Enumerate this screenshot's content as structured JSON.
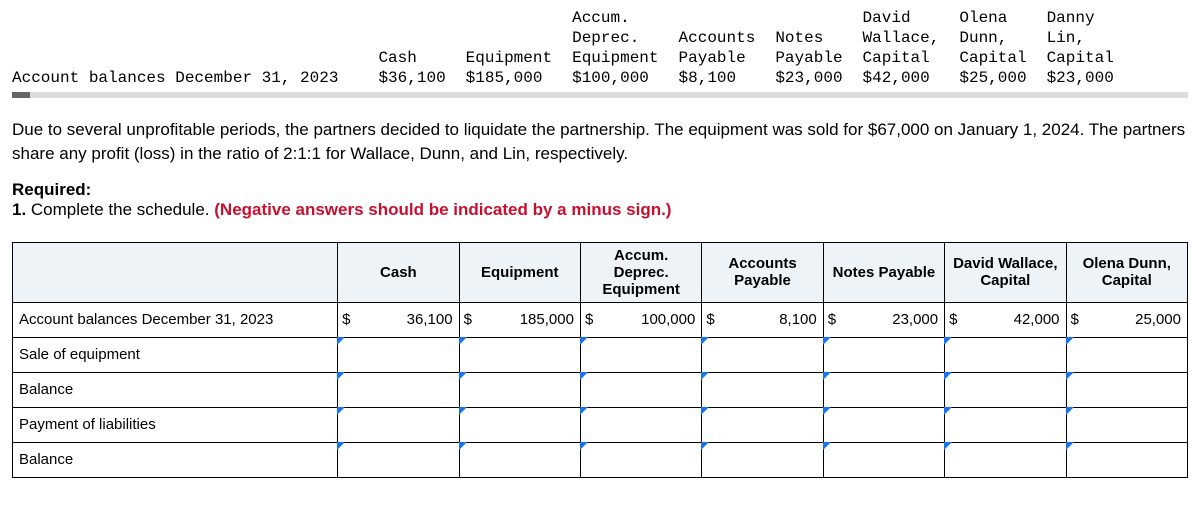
{
  "top": {
    "rowLabel": "Account balances December 31, 2023",
    "headers": {
      "cash": "Cash",
      "equipment": "Equipment",
      "accumHead": "Accum.\nDeprec.\nEquipment",
      "accounts": "Accounts\nPayable",
      "notes": "Notes\nPayable",
      "wallace": "David\nWallace,\nCapital",
      "dunn": "Olena\nDunn,\nCapital",
      "lin": "Danny\nLin,\nCapital"
    },
    "values": {
      "cash": "$36,100",
      "equipment": "$185,000",
      "accum": "$100,000",
      "accounts": "$8,100",
      "notes": "$23,000",
      "wallace": "$42,000",
      "dunn": "$25,000",
      "lin": "$23,000"
    }
  },
  "para": "Due to several unprofitable periods, the partners decided to liquidate the partnership. The equipment was sold for $67,000 on January 1, 2024. The partners share any profit (loss) in the ratio of 2:1:1 for Wallace, Dunn, and Lin, respectively.",
  "required": {
    "head": "Required:",
    "line_num": "1. ",
    "line_text": "Complete the schedule. ",
    "line_red": "(Negative answers should be indicated by a minus sign.)"
  },
  "schedule": {
    "headers": {
      "cash": "Cash",
      "equipment": "Equipment",
      "accum": "Accum. Deprec. Equipment",
      "accounts": "Accounts Payable",
      "notes": "Notes Payable",
      "wallace": "David Wallace, Capital",
      "dunn": "Olena Dunn, Capital"
    },
    "rows": {
      "r1": "Account balances December 31, 2023",
      "r2": "Sale of equipment",
      "r3": "Balance",
      "r4": "Payment of liabilities",
      "r5": "Balance"
    },
    "vals": {
      "cash": "36,100",
      "equipment": "185,000",
      "accum": "100,000",
      "accounts": "8,100",
      "notes": "23,000",
      "wallace": "42,000",
      "dunn": "25,000"
    },
    "currency": "$"
  },
  "chart_data": {
    "type": "table",
    "title": "Partnership liquidation schedule — opening balances",
    "columns": [
      "Cash",
      "Equipment",
      "Accum. Deprec. Equipment",
      "Accounts Payable",
      "Notes Payable",
      "David Wallace, Capital",
      "Olena Dunn, Capital",
      "Danny Lin, Capital"
    ],
    "rows": [
      {
        "label": "Account balances December 31, 2023",
        "values": [
          36100,
          185000,
          100000,
          8100,
          23000,
          42000,
          25000,
          23000
        ]
      }
    ],
    "notes": "Equipment sold for $67,000 on Jan 1, 2024; profit/loss ratio 2:1:1 (Wallace:Dunn:Lin)."
  }
}
